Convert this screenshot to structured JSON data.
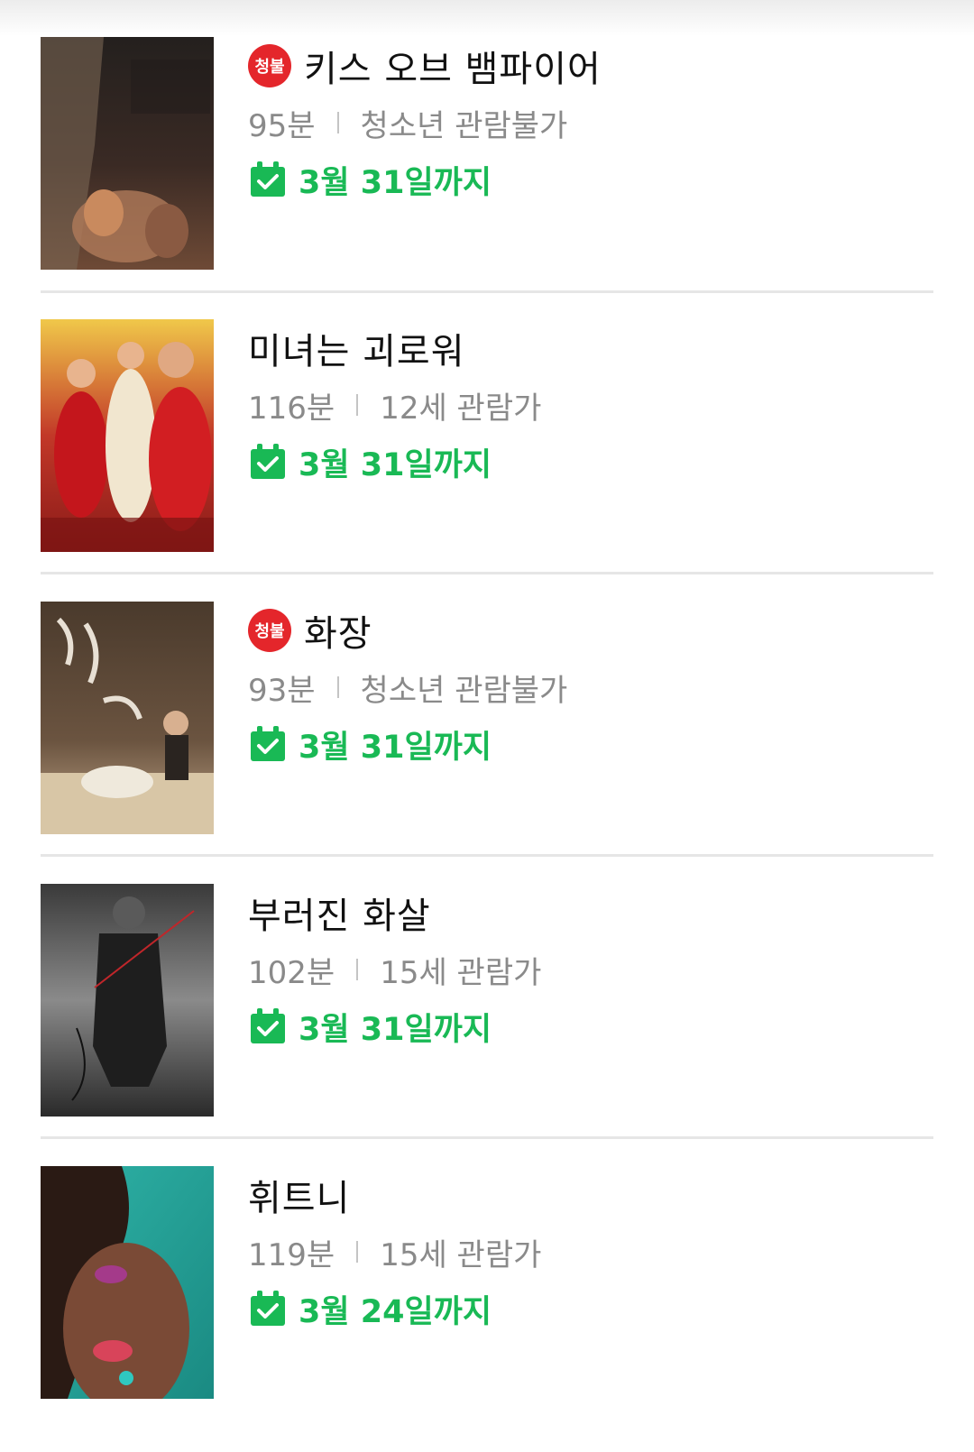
{
  "colors": {
    "accent_green": "#19b955",
    "rating_badge_red": "#e4262b",
    "meta_gray": "#8a8a8a",
    "divider": "#e6e6e6"
  },
  "movies": [
    {
      "title": "키스 오브 뱀파이어",
      "badge": "청불",
      "runtime": "95분",
      "rating": "청소년 관람불가",
      "available_until": "3월 31일까지",
      "icon": "calendar-check-icon"
    },
    {
      "title": "미녀는 괴로워",
      "badge": null,
      "runtime": "116분",
      "rating": "12세 관람가",
      "available_until": "3월 31일까지",
      "icon": "calendar-check-icon"
    },
    {
      "title": "화장",
      "badge": "청불",
      "runtime": "93분",
      "rating": "청소년 관람불가",
      "available_until": "3월 31일까지",
      "icon": "calendar-check-icon"
    },
    {
      "title": "부러진 화살",
      "badge": null,
      "runtime": "102분",
      "rating": "15세 관람가",
      "available_until": "3월 31일까지",
      "icon": "calendar-check-icon"
    },
    {
      "title": "휘트니",
      "badge": null,
      "runtime": "119분",
      "rating": "15세 관람가",
      "available_until": "3월 24일까지",
      "icon": "calendar-check-icon"
    }
  ]
}
